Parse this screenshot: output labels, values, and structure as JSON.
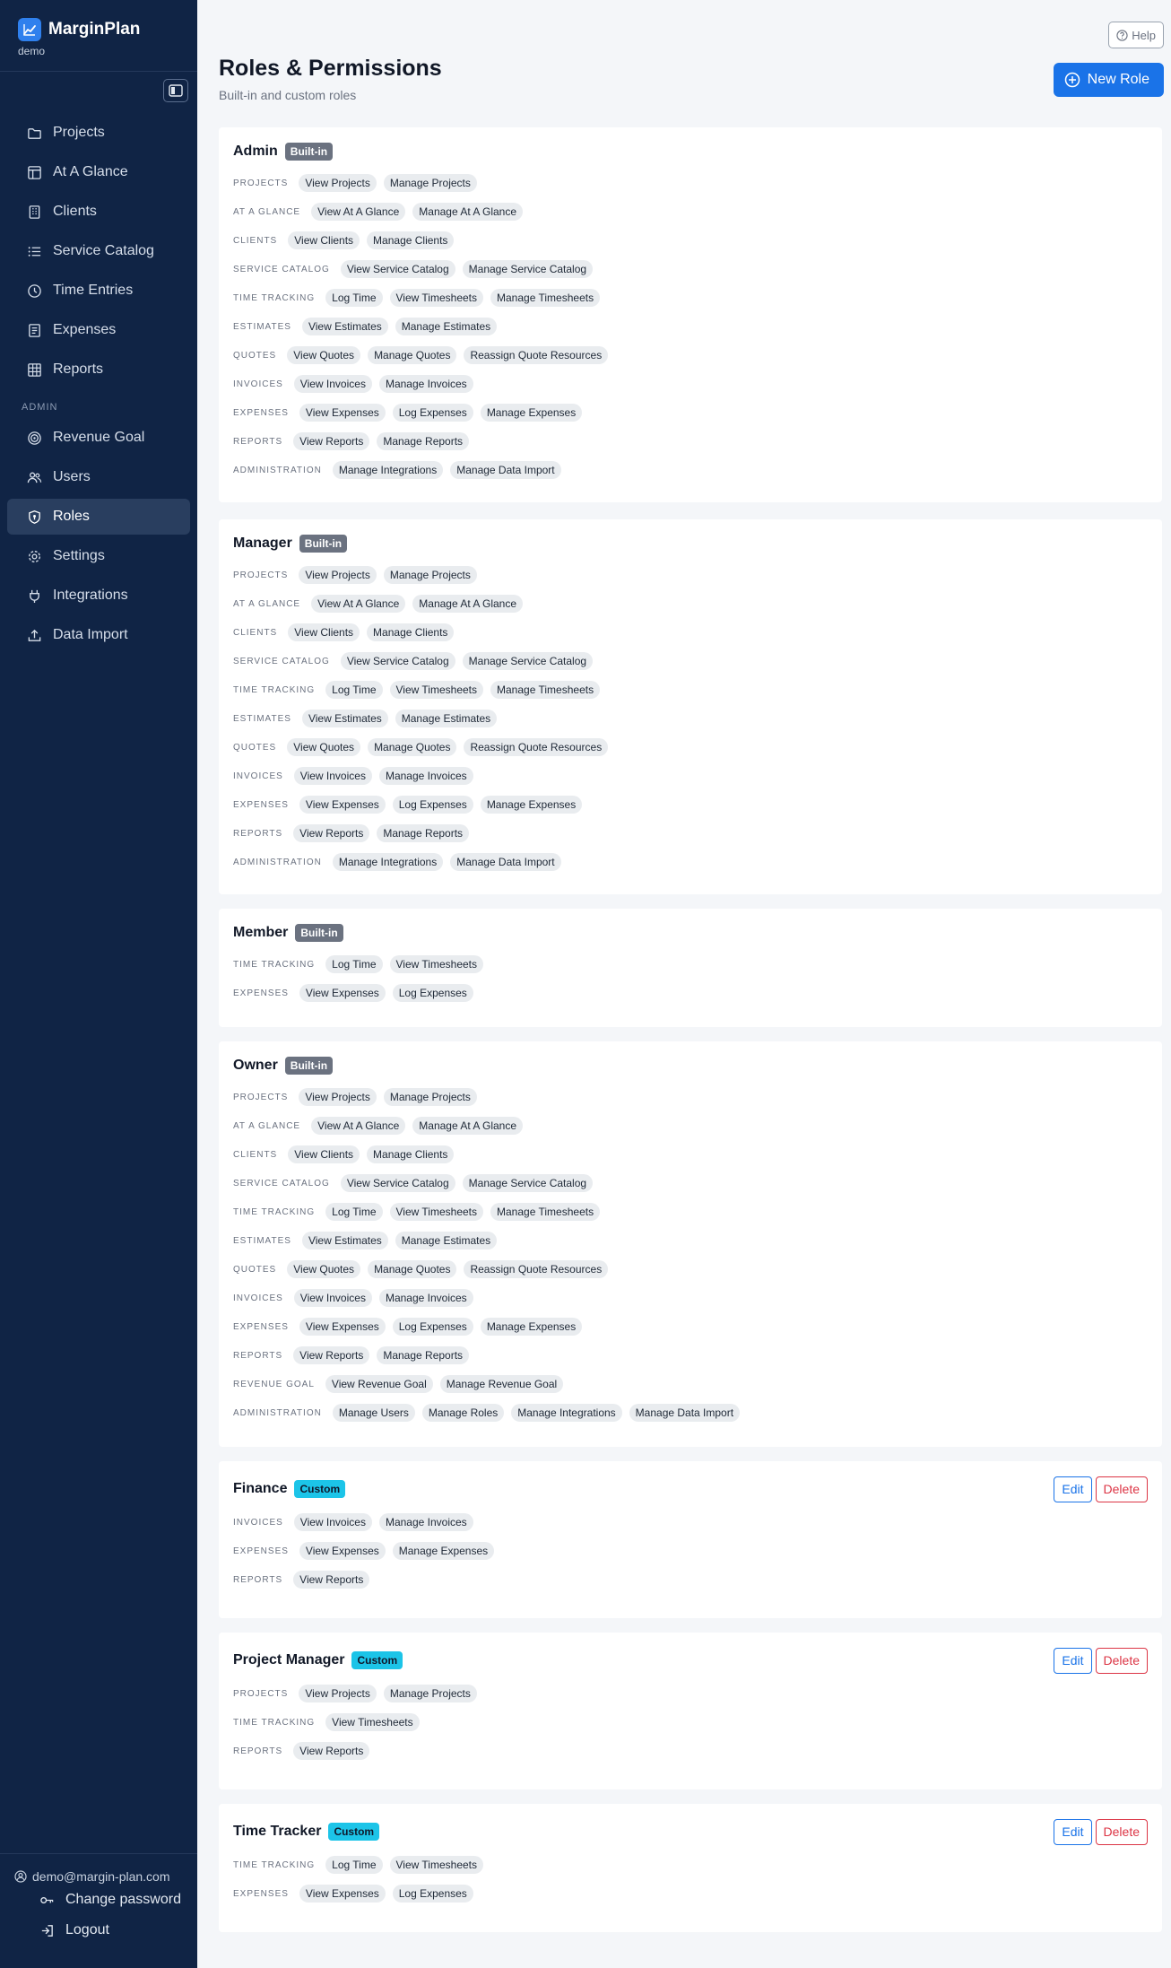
{
  "sidebar": {
    "brand": "MarginPlan",
    "subtitle": "demo",
    "items": [
      {
        "label": "Projects",
        "icon": "folder-icon"
      },
      {
        "label": "At A Glance",
        "icon": "dashboard-icon"
      },
      {
        "label": "Clients",
        "icon": "building-icon"
      },
      {
        "label": "Service Catalog",
        "icon": "list-icon"
      },
      {
        "label": "Time Entries",
        "icon": "clock-icon"
      },
      {
        "label": "Expenses",
        "icon": "receipt-icon"
      },
      {
        "label": "Reports",
        "icon": "table-icon"
      }
    ],
    "admin_label": "ADMIN",
    "admin_items": [
      {
        "label": "Revenue Goal",
        "icon": "target-icon"
      },
      {
        "label": "Users",
        "icon": "users-icon"
      },
      {
        "label": "Roles",
        "icon": "shield-icon",
        "active": true
      },
      {
        "label": "Settings",
        "icon": "gear-icon"
      },
      {
        "label": "Integrations",
        "icon": "plug-icon"
      },
      {
        "label": "Data Import",
        "icon": "upload-icon"
      }
    ],
    "footer": {
      "email": "demo@margin-plan.com",
      "change_password": "Change password",
      "logout": "Logout"
    }
  },
  "header": {
    "help": "Help",
    "title": "Roles & Permissions",
    "subtitle": "Built-in and custom roles",
    "new_role": "New Role"
  },
  "actions": {
    "edit": "Edit",
    "delete": "Delete"
  },
  "colors": {
    "sidebar_bg": "#102445",
    "primary": "#1a73e8",
    "danger": "#dc3545",
    "custom_badge": "#1cc4e8",
    "builtin_badge": "#6b7280"
  },
  "roles": [
    {
      "name": "Admin",
      "badge": "Built-in",
      "groups": [
        {
          "label": "PROJECTS",
          "perms": [
            "View Projects",
            "Manage Projects"
          ]
        },
        {
          "label": "AT A GLANCE",
          "perms": [
            "View At A Glance",
            "Manage At A Glance"
          ]
        },
        {
          "label": "CLIENTS",
          "perms": [
            "View Clients",
            "Manage Clients"
          ]
        },
        {
          "label": "SERVICE CATALOG",
          "perms": [
            "View Service Catalog",
            "Manage Service Catalog"
          ]
        },
        {
          "label": "TIME TRACKING",
          "perms": [
            "Log Time",
            "View Timesheets",
            "Manage Timesheets"
          ]
        },
        {
          "label": "ESTIMATES",
          "perms": [
            "View Estimates",
            "Manage Estimates"
          ]
        },
        {
          "label": "QUOTES",
          "perms": [
            "View Quotes",
            "Manage Quotes",
            "Reassign Quote Resources"
          ]
        },
        {
          "label": "INVOICES",
          "perms": [
            "View Invoices",
            "Manage Invoices"
          ]
        },
        {
          "label": "EXPENSES",
          "perms": [
            "View Expenses",
            "Log Expenses",
            "Manage Expenses"
          ]
        },
        {
          "label": "REPORTS",
          "perms": [
            "View Reports",
            "Manage Reports"
          ]
        },
        {
          "label": "ADMINISTRATION",
          "perms": [
            "Manage Integrations",
            "Manage Data Import"
          ]
        }
      ]
    },
    {
      "name": "Manager",
      "badge": "Built-in",
      "groups": [
        {
          "label": "PROJECTS",
          "perms": [
            "View Projects",
            "Manage Projects"
          ]
        },
        {
          "label": "AT A GLANCE",
          "perms": [
            "View At A Glance",
            "Manage At A Glance"
          ]
        },
        {
          "label": "CLIENTS",
          "perms": [
            "View Clients",
            "Manage Clients"
          ]
        },
        {
          "label": "SERVICE CATALOG",
          "perms": [
            "View Service Catalog",
            "Manage Service Catalog"
          ]
        },
        {
          "label": "TIME TRACKING",
          "perms": [
            "Log Time",
            "View Timesheets",
            "Manage Timesheets"
          ]
        },
        {
          "label": "ESTIMATES",
          "perms": [
            "View Estimates",
            "Manage Estimates"
          ]
        },
        {
          "label": "QUOTES",
          "perms": [
            "View Quotes",
            "Manage Quotes",
            "Reassign Quote Resources"
          ]
        },
        {
          "label": "INVOICES",
          "perms": [
            "View Invoices",
            "Manage Invoices"
          ]
        },
        {
          "label": "EXPENSES",
          "perms": [
            "View Expenses",
            "Log Expenses",
            "Manage Expenses"
          ]
        },
        {
          "label": "REPORTS",
          "perms": [
            "View Reports",
            "Manage Reports"
          ]
        },
        {
          "label": "ADMINISTRATION",
          "perms": [
            "Manage Integrations",
            "Manage Data Import"
          ]
        }
      ]
    },
    {
      "name": "Member",
      "badge": "Built-in",
      "groups": [
        {
          "label": "TIME TRACKING",
          "perms": [
            "Log Time",
            "View Timesheets"
          ]
        },
        {
          "label": "EXPENSES",
          "perms": [
            "View Expenses",
            "Log Expenses"
          ]
        }
      ]
    },
    {
      "name": "Owner",
      "badge": "Built-in",
      "groups": [
        {
          "label": "PROJECTS",
          "perms": [
            "View Projects",
            "Manage Projects"
          ]
        },
        {
          "label": "AT A GLANCE",
          "perms": [
            "View At A Glance",
            "Manage At A Glance"
          ]
        },
        {
          "label": "CLIENTS",
          "perms": [
            "View Clients",
            "Manage Clients"
          ]
        },
        {
          "label": "SERVICE CATALOG",
          "perms": [
            "View Service Catalog",
            "Manage Service Catalog"
          ]
        },
        {
          "label": "TIME TRACKING",
          "perms": [
            "Log Time",
            "View Timesheets",
            "Manage Timesheets"
          ]
        },
        {
          "label": "ESTIMATES",
          "perms": [
            "View Estimates",
            "Manage Estimates"
          ]
        },
        {
          "label": "QUOTES",
          "perms": [
            "View Quotes",
            "Manage Quotes",
            "Reassign Quote Resources"
          ]
        },
        {
          "label": "INVOICES",
          "perms": [
            "View Invoices",
            "Manage Invoices"
          ]
        },
        {
          "label": "EXPENSES",
          "perms": [
            "View Expenses",
            "Log Expenses",
            "Manage Expenses"
          ]
        },
        {
          "label": "REPORTS",
          "perms": [
            "View Reports",
            "Manage Reports"
          ]
        },
        {
          "label": "REVENUE GOAL",
          "perms": [
            "View Revenue Goal",
            "Manage Revenue Goal"
          ]
        },
        {
          "label": "ADMINISTRATION",
          "perms": [
            "Manage Users",
            "Manage Roles",
            "Manage Integrations",
            "Manage Data Import"
          ]
        }
      ]
    },
    {
      "name": "Finance",
      "badge": "Custom",
      "custom": true,
      "groups": [
        {
          "label": "INVOICES",
          "perms": [
            "View Invoices",
            "Manage Invoices"
          ]
        },
        {
          "label": "EXPENSES",
          "perms": [
            "View Expenses",
            "Manage Expenses"
          ]
        },
        {
          "label": "REPORTS",
          "perms": [
            "View Reports"
          ]
        }
      ]
    },
    {
      "name": "Project Manager",
      "badge": "Custom",
      "custom": true,
      "groups": [
        {
          "label": "PROJECTS",
          "perms": [
            "View Projects",
            "Manage Projects"
          ]
        },
        {
          "label": "TIME TRACKING",
          "perms": [
            "View Timesheets"
          ]
        },
        {
          "label": "REPORTS",
          "perms": [
            "View Reports"
          ]
        }
      ]
    },
    {
      "name": "Time Tracker",
      "badge": "Custom",
      "custom": true,
      "groups": [
        {
          "label": "TIME TRACKING",
          "perms": [
            "Log Time",
            "View Timesheets"
          ]
        },
        {
          "label": "EXPENSES",
          "perms": [
            "View Expenses",
            "Log Expenses"
          ]
        }
      ]
    }
  ]
}
